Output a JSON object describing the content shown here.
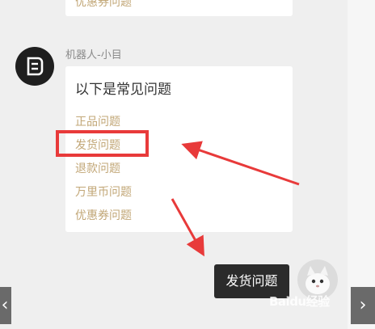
{
  "chat": {
    "previous_bubble_text": "优惠券问题",
    "bot_name": "机器人-小目",
    "bot_message": {
      "title": "以下是常见问题",
      "items": [
        "正品问题",
        "发货问题",
        "退款问题",
        "万里币问题",
        "优惠券问题"
      ]
    },
    "user_message": "发货问题"
  },
  "nav": {
    "prev_icon": "‹",
    "next_icon": "›"
  },
  "watermark": "Baidu经验",
  "colors": {
    "background": "#efefef",
    "link_gold": "#c2a777",
    "highlight_red": "#e83a3a",
    "user_bubble": "#2b2b2b"
  }
}
